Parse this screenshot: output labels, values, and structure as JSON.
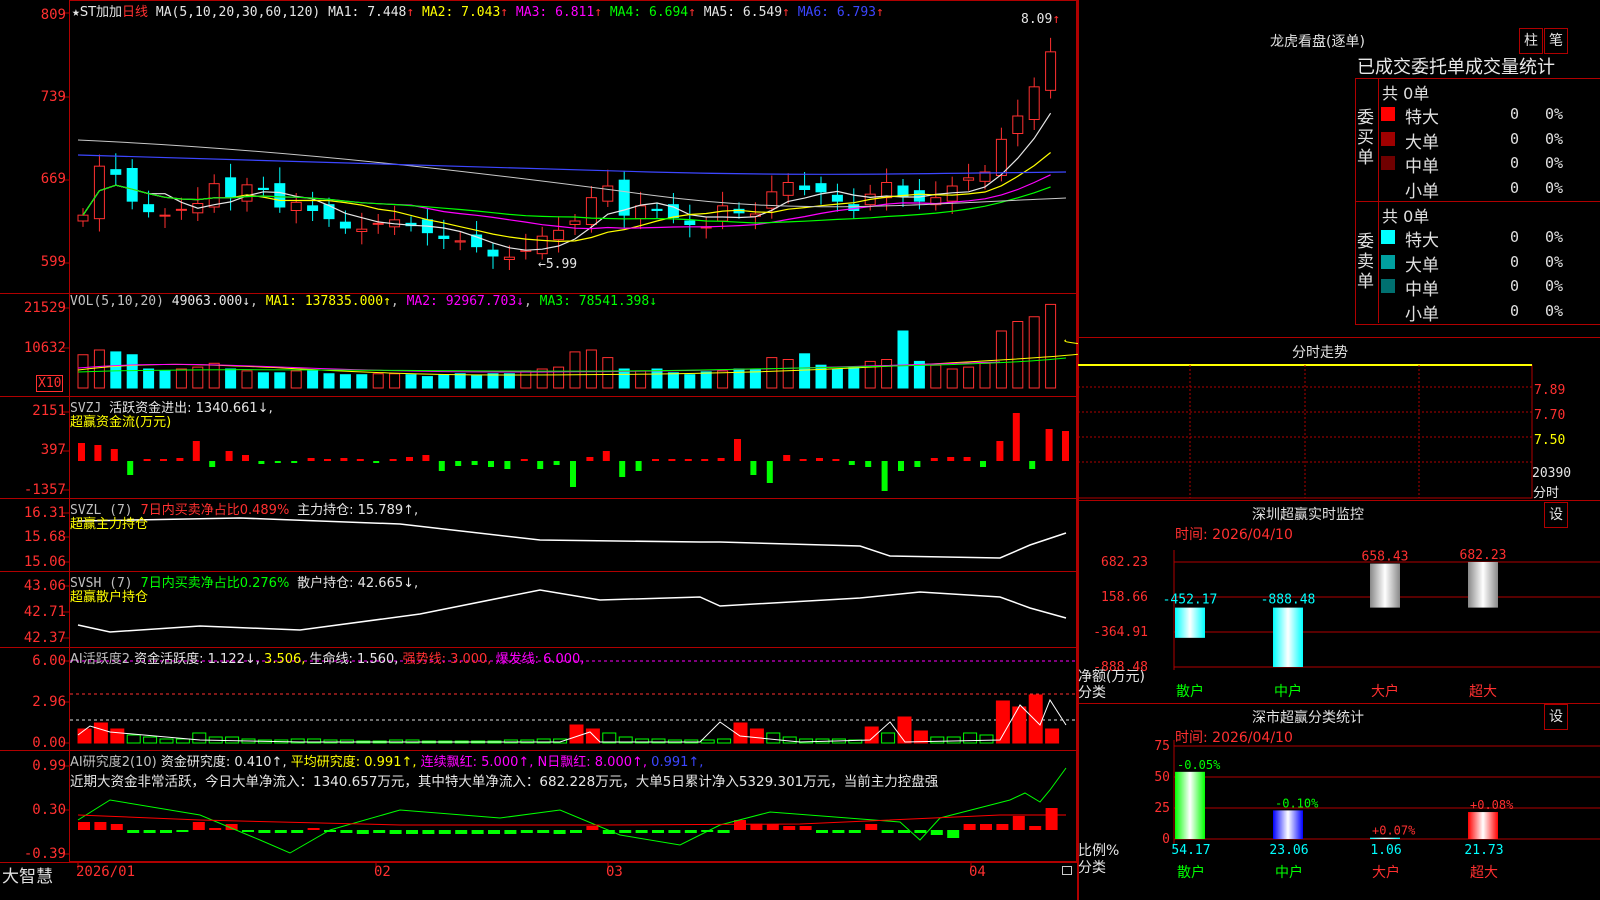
{
  "header": {
    "star": "★",
    "stock_name": "ST加加",
    "period": "日线",
    "ma_params": "MA(5,10,20,30,60,120)",
    "ma": [
      {
        "label": "MA1:",
        "value": "7.448↑",
        "color": "#e6e6e6"
      },
      {
        "label": "MA2:",
        "value": "7.043↑",
        "color": "#ffff00"
      },
      {
        "label": "MA3:",
        "value": "6.811↑",
        "color": "#ff00ff"
      },
      {
        "label": "MA4:",
        "value": "6.694↑",
        "color": "#00ff00"
      },
      {
        "label": "MA5:",
        "value": "6.549↑",
        "color": "#e6e6e6"
      },
      {
        "label": "MA6:",
        "value": "6.793↑",
        "color": "#3c46ff"
      }
    ],
    "max_marker": "8.09",
    "min_marker": "←5.99"
  },
  "main_axis": [
    "809",
    "739",
    "669",
    "599"
  ],
  "vol": {
    "title": "VOL(5,10,20)",
    "value": "49063.000↓",
    "ma1": "MA1: 137835.000↑",
    "ma2": "MA2: 92967.703↓",
    "ma3": "MA3: 78541.398↓",
    "axis": [
      "21529",
      "10632"
    ],
    "unit": "X10"
  },
  "svzj": {
    "title": "SVZJ",
    "active_label": "活跃资金进出: 1340.661↓,",
    "subtitle": "超赢资金流(万元)",
    "axis": [
      "2151",
      "397",
      "-1357"
    ]
  },
  "svzl": {
    "title": "SVZL (7)",
    "net_ratio": "7日内买卖净占比0.489%",
    "hold": "主力持仓: 15.789↑,",
    "subtitle": "超赢主力持仓",
    "axis": [
      "16.31",
      "15.68",
      "15.06"
    ]
  },
  "svsh": {
    "title": "SVSH (7)",
    "net_ratio": "7日内买卖净占比0.276%",
    "hold": "散户持仓: 42.665↓,",
    "subtitle": "超赢散户持仓",
    "axis": [
      "43.06",
      "42.71",
      "42.37"
    ]
  },
  "ai_active": {
    "title": "AI活跃度2",
    "fund": "资金活跃度: 1.122↓,",
    "v2": "3.506,",
    "life": "生命线: 1.560,",
    "strong": "强势线: 3.000,",
    "burst": "爆发线: 6.000,",
    "axis": [
      "6.00",
      "2.96",
      "0.00"
    ]
  },
  "ai_research": {
    "title": "AI研究度2(10)",
    "fund": "资金研究度: 0.410↑,",
    "avg": "平均研究度: 0.991↑,",
    "cont": "连续飘红: 5.000↑,",
    "nday": "N日飘红: 8.000↑,",
    "last": "0.991↑,",
    "comment": "近期大资金非常活跃，今日大单净流入：1340.657万元，其中特大单净流入：682.228万元，大单5日累计净入5329.301万元，当前主力控盘强",
    "axis": [
      "0.99",
      "0.30",
      "-0.39"
    ]
  },
  "xaxis": [
    "2026/01",
    "02",
    "03",
    "04"
  ],
  "brand": "大智慧",
  "right": {
    "title": "龙虎看盘(逐单)",
    "btn_bar": "柱",
    "btn_pen": "笔",
    "stats_title": "已成交委托单成交量统计",
    "buy_label": "委买单",
    "sell_label": "委卖单",
    "buy_total": "共 0单",
    "sell_total": "共 0单",
    "buy_rows": [
      {
        "name": "特大",
        "count": "0",
        "pct": "0%",
        "color": "#ff0000"
      },
      {
        "name": "大单",
        "count": "0",
        "pct": "0%",
        "color": "#a00000"
      },
      {
        "name": "中单",
        "count": "0",
        "pct": "0%",
        "color": "#700000"
      },
      {
        "name": "小单",
        "count": "0",
        "pct": "0%",
        "color": "#000000"
      }
    ],
    "sell_rows": [
      {
        "name": "特大",
        "count": "0",
        "pct": "0%",
        "color": "#00ffff"
      },
      {
        "name": "大单",
        "count": "0",
        "pct": "0%",
        "color": "#00a0a0"
      },
      {
        "name": "中单",
        "count": "0",
        "pct": "0%",
        "color": "#007070"
      },
      {
        "name": "小单",
        "count": "0",
        "pct": "0%",
        "color": "#000000"
      }
    ],
    "intraday": {
      "title": "分时走势",
      "axis": [
        "7.89",
        "7.70",
        "7.50"
      ],
      "vol": "20390",
      "vol_unit": "分时"
    },
    "monitor": {
      "title": "深圳超赢实时监控",
      "btn": "设",
      "time": "时间: 2026/04/10",
      "axis": [
        "682.23",
        "158.66",
        "-364.91",
        "-888.48"
      ],
      "ylabel1": "净额(万元)",
      "ylabel2": "分类",
      "categories": [
        "散户",
        "中户",
        "大户",
        "超大"
      ],
      "values": [
        "-452.17",
        "-888.48",
        "658.43",
        "682.23"
      ],
      "nums": [
        -452.17,
        -888.48,
        658.43,
        682.23
      ]
    },
    "classify": {
      "title": "深市超赢分类统计",
      "btn": "设",
      "time": "时间: 2026/04/10",
      "axis": [
        "75",
        "50",
        "25",
        "0"
      ],
      "ylabel1": "比例%",
      "ylabel2": "分类",
      "categories": [
        "散户",
        "中户",
        "大户",
        "超大"
      ],
      "values": [
        "54.17",
        "23.06",
        "1.06",
        "21.73"
      ],
      "nums": [
        54.17,
        23.06,
        1.06,
        21.73
      ],
      "changes": [
        "-0.05%",
        "-0.10%",
        "+0.07%",
        "+0.08%"
      ],
      "colors": [
        "#00ff00",
        "#0000ff",
        "#00ffff",
        "#ff0000"
      ]
    }
  }
}
